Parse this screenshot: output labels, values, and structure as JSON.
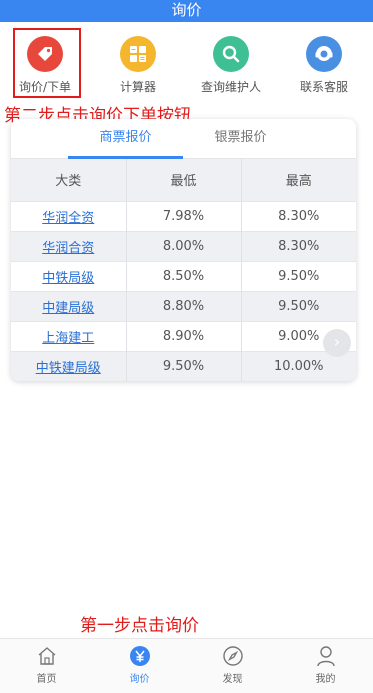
{
  "header": {
    "title": "询价"
  },
  "quick_actions": [
    {
      "label": "询价/下单",
      "icon": "price-tag-icon",
      "color": "#e8473b"
    },
    {
      "label": "计算器",
      "icon": "calculator-icon",
      "color": "#f3b62d"
    },
    {
      "label": "查询维护人",
      "icon": "search-icon",
      "color": "#3fbf94"
    },
    {
      "label": "联系客服",
      "icon": "headset-icon",
      "color": "#4a90e2"
    }
  ],
  "annotations": {
    "step2": "第二步点击询价下单按钮",
    "step1": "第一步点击询价"
  },
  "tabs": [
    {
      "label": "商票报价",
      "active": true
    },
    {
      "label": "银票报价",
      "active": false
    }
  ],
  "table": {
    "headers": [
      "大类",
      "最低",
      "最高"
    ],
    "rows": [
      {
        "name": "华润全资",
        "low": "7.98%",
        "high": "8.30%"
      },
      {
        "name": "华润合资",
        "low": "8.00%",
        "high": "8.30%"
      },
      {
        "name": "中铁局级",
        "low": "8.50%",
        "high": "9.50%"
      },
      {
        "name": "中建局级",
        "low": "8.80%",
        "high": "9.50%"
      },
      {
        "name": "上海建工",
        "low": "8.90%",
        "high": "9.00%"
      },
      {
        "name": "中铁建局级",
        "low": "9.50%",
        "high": "10.00%"
      }
    ]
  },
  "scroll_arrow": "›",
  "bottom_nav": [
    {
      "label": "首页",
      "icon": "home-icon",
      "active": false
    },
    {
      "label": "询价",
      "icon": "yen-icon",
      "active": true
    },
    {
      "label": "发现",
      "icon": "compass-icon",
      "active": false
    },
    {
      "label": "我的",
      "icon": "user-icon",
      "active": false
    }
  ],
  "colors": {
    "accent": "#3a86f0",
    "annotation": "#e21b1b"
  }
}
